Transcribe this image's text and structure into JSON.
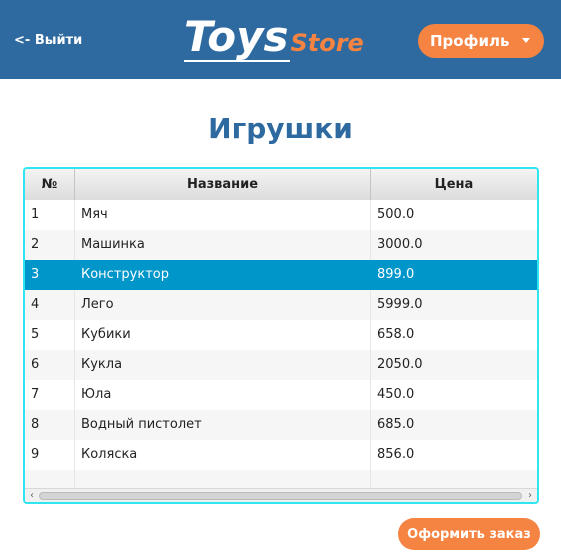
{
  "header": {
    "logout_label": "<- Выйти",
    "logo_main": "Toys",
    "logo_sub": "Store",
    "profile_label": "Профиль",
    "colors": {
      "header_bg": "#2e6aa0",
      "accent": "#f58442"
    }
  },
  "page_title": "Игрушки",
  "table": {
    "columns": [
      "№",
      "Название",
      "Цена"
    ],
    "selected_row_index": 2,
    "rows": [
      [
        "1",
        "Мяч",
        "500.0"
      ],
      [
        "2",
        "Машинка",
        "3000.0"
      ],
      [
        "3",
        "Конструктор",
        "899.0"
      ],
      [
        "4",
        "Лего",
        "5999.0"
      ],
      [
        "5",
        "Кубики",
        "658.0"
      ],
      [
        "6",
        "Кукла",
        "2050.0"
      ],
      [
        "7",
        "Юла",
        "450.0"
      ],
      [
        "8",
        "Водный пистолет",
        "685.0"
      ],
      [
        "9",
        "Коляска",
        "856.0"
      ]
    ]
  },
  "scrollbar": {
    "left_icon": "arrow-left-icon",
    "right_icon": "arrow-right-icon"
  },
  "order_button_label": "Оформить заказ"
}
